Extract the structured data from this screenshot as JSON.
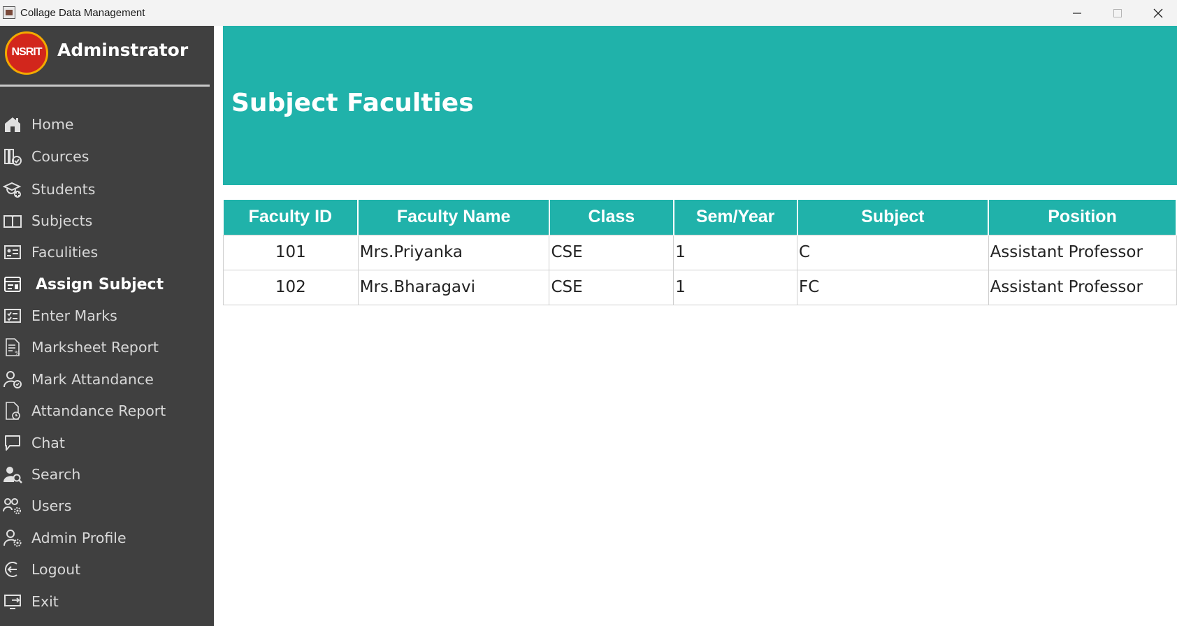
{
  "window": {
    "title": "Collage Data Management",
    "app_icon": "app-icon",
    "controls": [
      "minimize-icon",
      "maximize-icon",
      "close-icon"
    ]
  },
  "sidebar": {
    "logo_text": "NSRIT",
    "title": "Adminstrator",
    "items": [
      {
        "label": "Home",
        "icon": "home-icon"
      },
      {
        "label": "Cources",
        "icon": "courses-icon"
      },
      {
        "label": "Students",
        "icon": "students-icon"
      },
      {
        "label": "Subjects",
        "icon": "book-icon"
      },
      {
        "label": "Faculities",
        "icon": "faculty-id-icon"
      },
      {
        "label": "Assign Subject",
        "icon": "assign-icon",
        "active": true
      },
      {
        "label": "Enter Marks",
        "icon": "marks-form-icon"
      },
      {
        "label": "Marksheet Report",
        "icon": "report-document-icon"
      },
      {
        "label": "Mark Attandance",
        "icon": "user-check-icon"
      },
      {
        "label": "Attandance Report",
        "icon": "document-clock-icon"
      },
      {
        "label": "Chat",
        "icon": "chat-icon"
      },
      {
        "label": "Search",
        "icon": "user-search-icon"
      },
      {
        "label": "Users",
        "icon": "users-gear-icon"
      },
      {
        "label": "Admin Profile",
        "icon": "user-gear-icon"
      },
      {
        "label": "Logout",
        "icon": "logout-icon"
      },
      {
        "label": "Exit",
        "icon": "exit-icon"
      }
    ]
  },
  "header": {
    "title": "Subject Faculties"
  },
  "table": {
    "columns": [
      "Faculty ID",
      "Faculty Name",
      "Class",
      "Sem/Year",
      "Subject",
      "Position"
    ],
    "rows": [
      [
        "101",
        "Mrs.Priyanka",
        "CSE",
        "1",
        "C",
        "Assistant Professor"
      ],
      [
        "102",
        "Mrs.Bharagavi",
        "CSE",
        "1",
        "FC",
        "Assistant Professor"
      ]
    ]
  },
  "colors": {
    "sidebar_bg": "#404040",
    "accent_teal": "#20b2aa",
    "titlebar_bg": "#f3f3f3"
  }
}
